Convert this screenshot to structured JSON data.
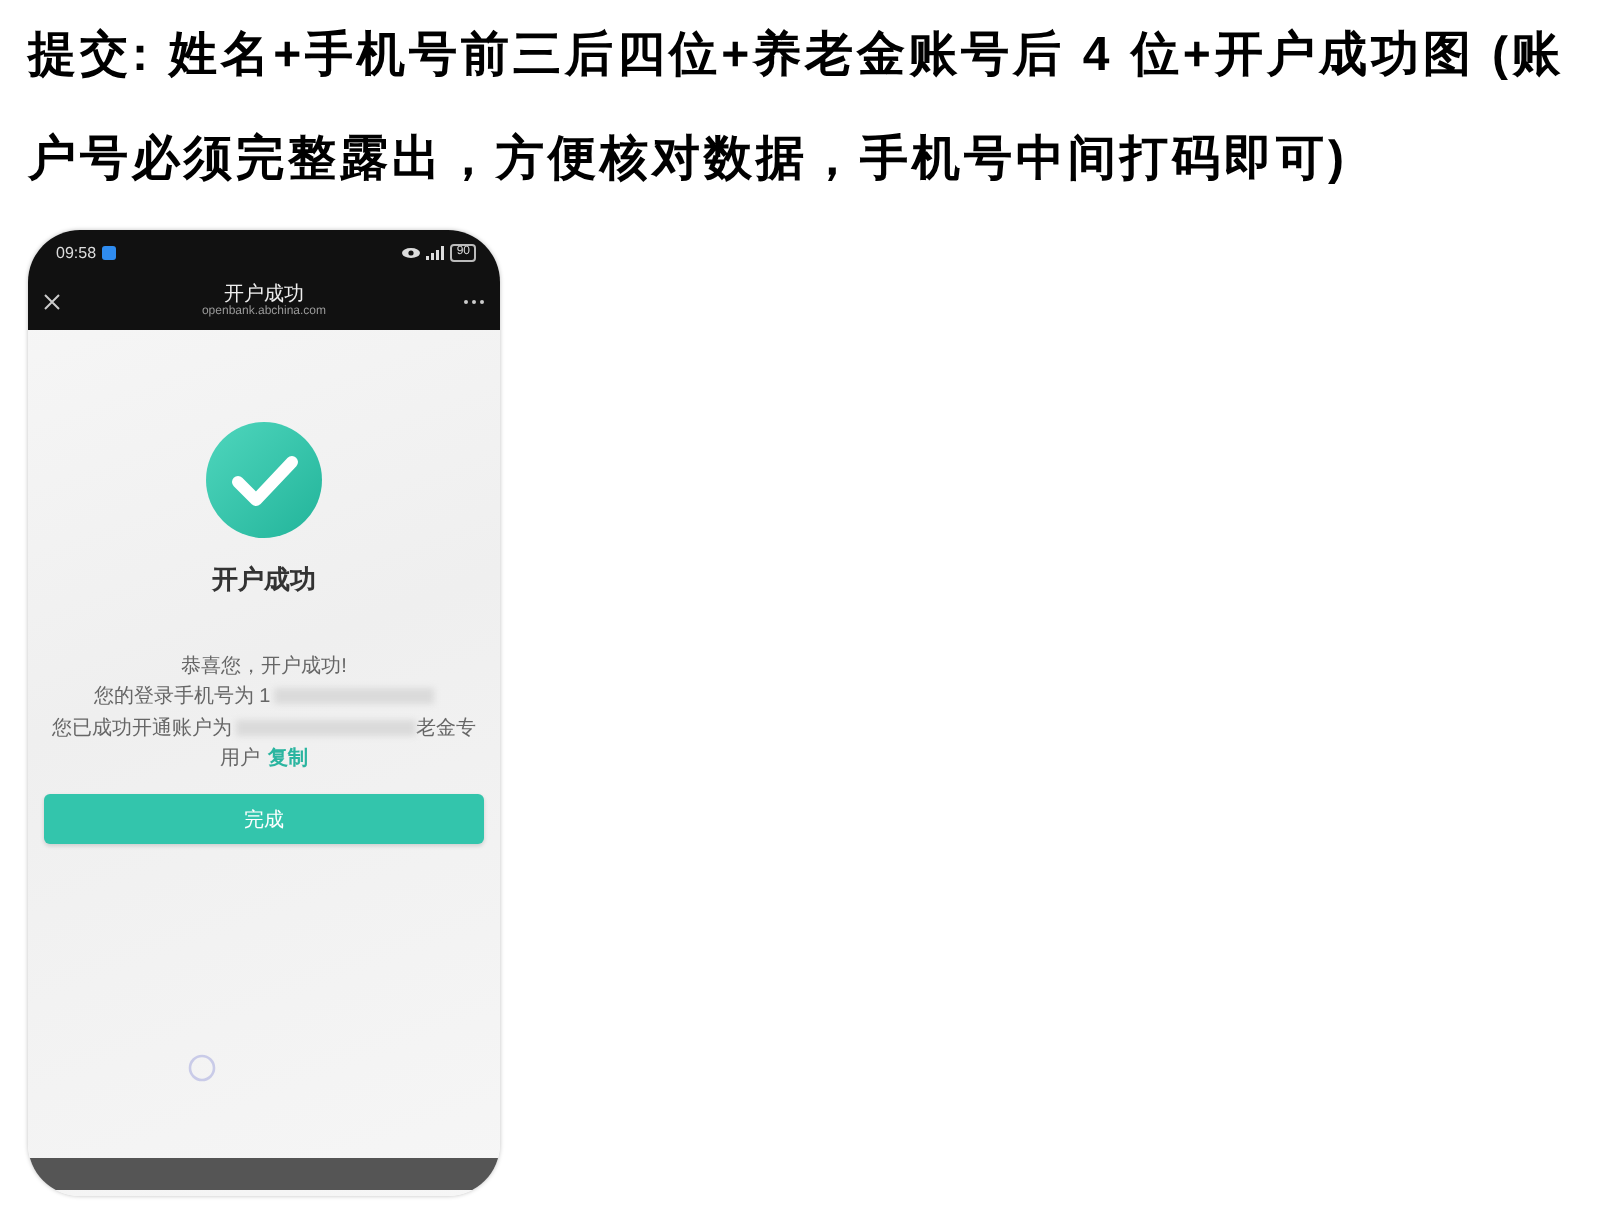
{
  "instruction": {
    "text": "提交: 姓名+手机号前三后四位+养老金账号后 4 位+开户成功图 (账户号必须完整露出，方便核对数据，手机号中间打码即可)"
  },
  "screenshot": {
    "status_bar": {
      "time": "09:58",
      "battery": "90"
    },
    "nav_bar": {
      "title": "开户成功",
      "url": "openbank.abchina.com"
    },
    "heading": "开户成功",
    "lines": [
      {
        "kind": "plain",
        "text": "恭喜您，开户成功!"
      },
      {
        "kind": "masked",
        "before": "您的登录手机号为 1"
      },
      {
        "kind": "masked",
        "before": "您已成功开通账户为",
        "after": "老金专"
      },
      {
        "kind": "link",
        "text": "用户",
        "link": "复制"
      }
    ],
    "button": "完成"
  }
}
